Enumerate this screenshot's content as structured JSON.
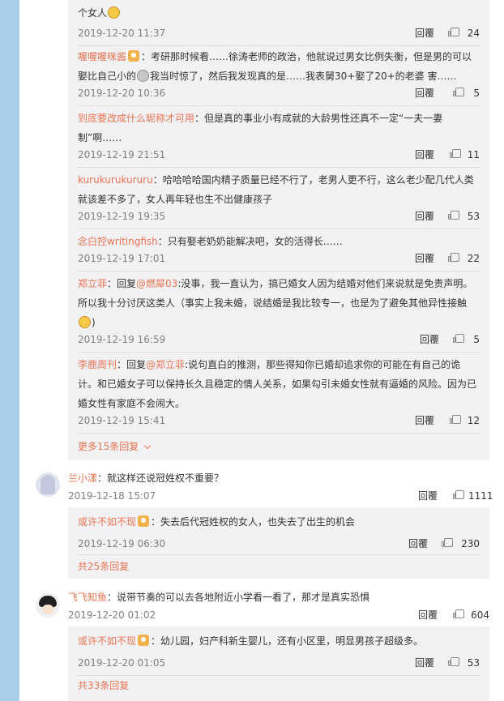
{
  "reply_label": "回覆",
  "block1": {
    "comments": [
      {
        "user": "",
        "badge": false,
        "text": "个女人",
        "emoji": "laugh-emoji",
        "time": "2019-12-20 11:37",
        "likes": "24"
      },
      {
        "user": "喔喔喔咪酱",
        "badge": true,
        "text_a": "：考研那时候看……徐涛老师的政治，他就说过男女比例失衡，但是男的可以娶比自己小的",
        "text_b": "我当时惊了，然后我发现真的是……我表舅30+娶了20+的老婆 害……",
        "time": "2019-12-20 10:36",
        "likes": "5"
      },
      {
        "user": "到底要改成什么昵称才可用",
        "badge": false,
        "text": "：但是真的事业小有成就的大龄男性还真不一定“一夫一妻制”啊……",
        "time": "2019-12-19 21:51",
        "likes": "11"
      },
      {
        "user": "kurukurukururu",
        "badge": false,
        "text": "：哈哈哈哈国内精子质量已经不行了，老男人更不行，这么老少配几代人类就该差不多了，女人再年轻也生不出健康孩子",
        "time": "2019-12-19 19:35",
        "likes": "53"
      },
      {
        "user": "念白控writingfish",
        "badge": false,
        "text": "：只有娶老奶奶能解决吧，女的活得长……",
        "time": "2019-12-19 17:01",
        "likes": "22"
      },
      {
        "user": "郑立菲",
        "badge": false,
        "reply_prefix": "：回复",
        "at": "@燃犀03",
        "text": ":没事，我一直认为，搞已婚女人因为结婚对他们来说就是免责声明。所以我十分讨厌这类人（事实上我未婚，说结婚是我比较专一，也是为了避免其他异性接触",
        "text_end": ")",
        "time": "2019-12-19 16:59",
        "likes": "5"
      },
      {
        "user": "李鹿周刊",
        "badge": false,
        "reply_prefix": "：回复",
        "at": "@郑立菲",
        "text": ":说句直白的推测，那些得知你已婚却追求你的可能在有自己的诡计。和已婚女子可以保持长久且稳定的情人关系，如果勾引未婚女性就有逼婚的风险。因为已婚女性有家庭不会闹大。",
        "time": "2019-12-19 15:41",
        "likes": "12"
      }
    ],
    "more": "更多15条回复"
  },
  "top2": {
    "user": "兰小漾",
    "text": "：就这样还说冠姓权不重要？",
    "time": "2019-12-18 15:07",
    "likes": "1111"
  },
  "block2": {
    "comment": {
      "user": "或许不如不现",
      "badge": true,
      "text": "：失去后代冠姓权的女人，也失去了出生的机会",
      "time": "2019-12-19 06:30",
      "likes": "230"
    },
    "more": "共25条回复"
  },
  "top3": {
    "user": "飞飞知鱼",
    "text": "：说带节奏的可以去各地附近小学看一看了，那才是真实恐惧",
    "time": "2019-12-20 01:02",
    "likes": "604"
  },
  "block3": {
    "comment": {
      "user": "或许不如不现",
      "badge": true,
      "text": "：幼儿园，妇产科新生婴儿，还有小区里，明显男孩子超级多。",
      "time": "2019-12-20 01:05",
      "likes": "53"
    },
    "more": "共33条回复"
  }
}
